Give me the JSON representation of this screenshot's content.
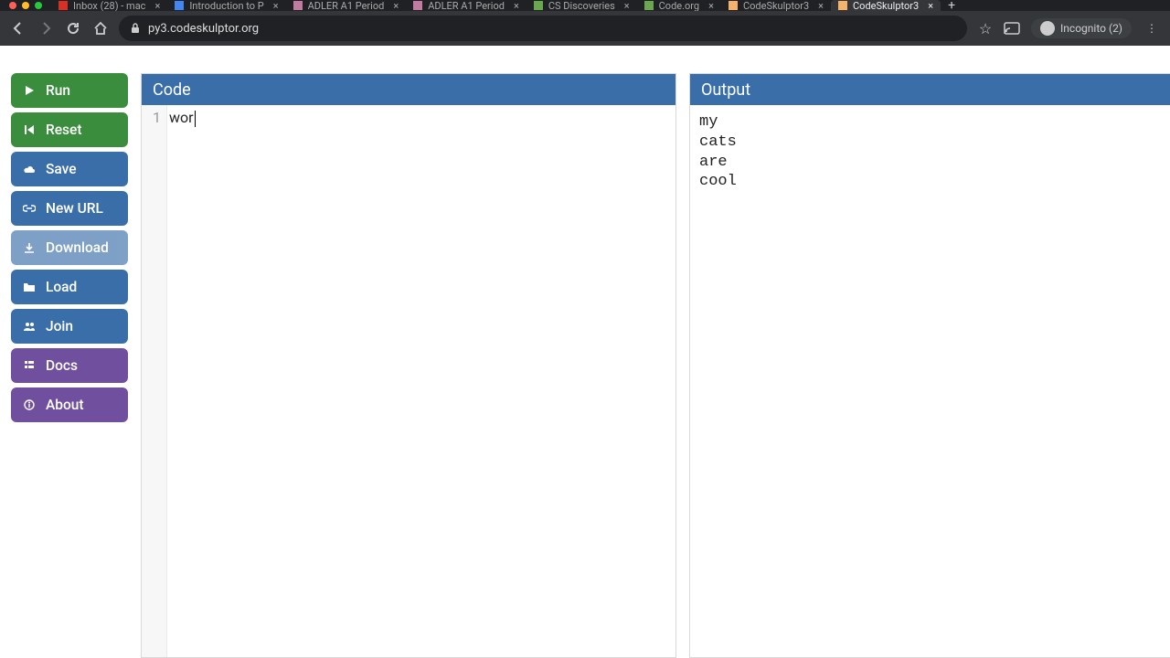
{
  "browser": {
    "tabs": [
      {
        "label": "Inbox (28) - mac",
        "fav": "#d93025"
      },
      {
        "label": "Introduction to P",
        "fav": "#4285f4"
      },
      {
        "label": "ADLER A1 Period",
        "fav": "#c27ba0"
      },
      {
        "label": "ADLER A1 Period",
        "fav": "#c27ba0"
      },
      {
        "label": "CS Discoveries",
        "fav": "#6aa84f"
      },
      {
        "label": "Code.org",
        "fav": "#6aa84f"
      },
      {
        "label": "CodeSkulptor3",
        "fav": "#f6b26b"
      },
      {
        "label": "CodeSkulptor3",
        "fav": "#f6b26b",
        "active": true
      }
    ],
    "url": "py3.codeskulptor.org",
    "incognito": "Incognito (2)"
  },
  "sidebar": {
    "run": "Run",
    "reset": "Reset",
    "save": "Save",
    "newurl": "New URL",
    "download": "Download",
    "load": "Load",
    "join": "Join",
    "docs": "Docs",
    "about": "About"
  },
  "panels": {
    "code_title": "Code",
    "output_title": "Output"
  },
  "editor": {
    "line_no": "1",
    "line_text": "wor"
  },
  "output_lines": [
    "my",
    "cats",
    "are",
    "cool"
  ]
}
